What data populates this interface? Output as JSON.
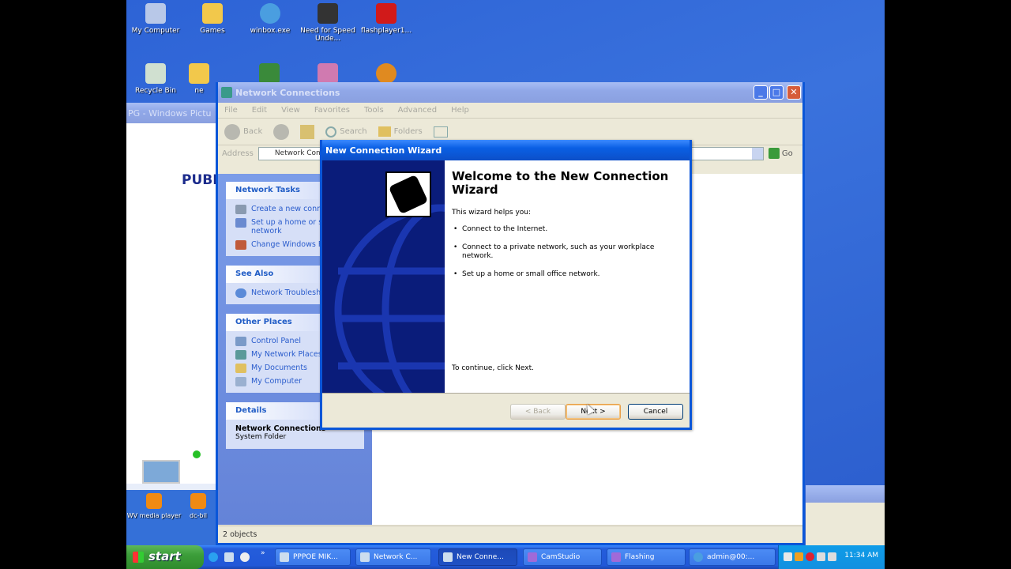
{
  "desktop": {
    "icons": [
      {
        "label": "My Computer",
        "color": "#b8c8e8"
      },
      {
        "label": "Games",
        "color": "#f2c84b"
      },
      {
        "label": "winbox.exe",
        "color": "#4a9ee0"
      },
      {
        "label": "Need for Speed Unde...",
        "color": "#333333"
      },
      {
        "label": "flashplayer1...",
        "color": "#d11a1a"
      },
      {
        "label": "Recycle Bin",
        "color": "#d0e0d0"
      },
      {
        "label": "ne",
        "color": "#f2c84b"
      }
    ],
    "bg_window_title": "PG - Windows Pictu",
    "bg_text": "PUBI"
  },
  "nc_window": {
    "title": "Network Connections",
    "menu": [
      "File",
      "Edit",
      "View",
      "Favorites",
      "Tools",
      "Advanced",
      "Help"
    ],
    "toolbar": {
      "back": "Back",
      "search": "Search",
      "folders": "Folders"
    },
    "address_label": "Address",
    "address_value": "Network Conn",
    "go": "Go",
    "tasks": {
      "network_tasks": {
        "title": "Network Tasks",
        "items": [
          "Create a new conn",
          "Set up a home or s office network",
          "Change Windows F settings"
        ]
      },
      "see_also": {
        "title": "See Also",
        "items": [
          "Network Troublesh"
        ]
      },
      "other_places": {
        "title": "Other Places",
        "items": [
          "Control Panel",
          "My Network Places",
          "My Documents",
          "My Computer"
        ]
      },
      "details": {
        "title": "Details",
        "name": "Network Connections",
        "type": "System Folder"
      }
    },
    "status": "2 objects"
  },
  "wizard": {
    "title": "New Connection Wizard",
    "heading": "Welcome to the New Connection Wizard",
    "intro": "This wizard helps you:",
    "bullets": [
      "Connect to the Internet.",
      "Connect to a private network, such as your workplace network.",
      "Set up a home or small office network."
    ],
    "continue": "To continue, click Next.",
    "back_button": "< Back",
    "next_button": "Next >",
    "cancel_button": "Cancel"
  },
  "bottom_icons": [
    {
      "label": "WV media player"
    },
    {
      "label": "dc-bil"
    }
  ],
  "taskbar": {
    "start": "start",
    "items": [
      "PPPOE MIK...",
      "Network C...",
      "New Conne...",
      "CamStudio",
      "Flashing",
      "admin@00:..."
    ],
    "clock": "11:34 AM"
  },
  "colors": {
    "xp_blue": "#0a56d8",
    "desktop": "#3a72dd",
    "start_green": "#3c9e3a"
  }
}
